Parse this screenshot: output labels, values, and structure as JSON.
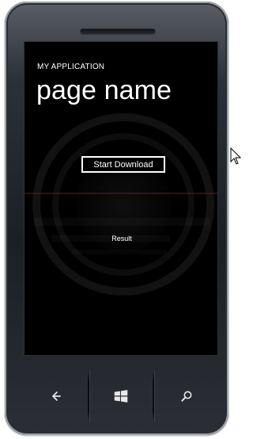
{
  "app": {
    "title": "MY APPLICATION",
    "page_name": "page name"
  },
  "main": {
    "start_button_label": "Start Download",
    "result_text": "Result"
  },
  "icons": {
    "back": "back-arrow-icon",
    "start": "windows-logo-icon",
    "search": "search-icon",
    "cursor": "mouse-cursor-icon"
  },
  "colors": {
    "screen_bg": "#000000",
    "text": "#ffffff",
    "phone_frame": "#2c3137"
  }
}
